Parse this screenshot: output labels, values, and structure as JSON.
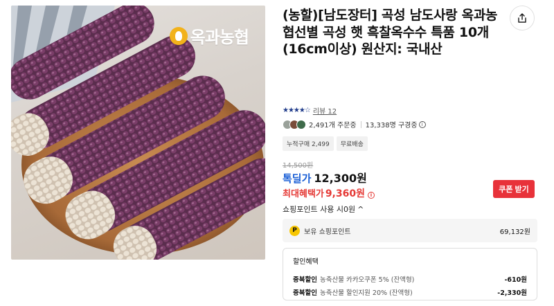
{
  "product": {
    "brand_logo_text": "옥과농협",
    "title": "(농할)[남도장터] 곡성 남도사랑 옥과농협선별 곡성 햇 흑찰옥수수 특품 10개 (16cm이상) 원산지: 국내산"
  },
  "rating": {
    "stars": "★★★★☆",
    "review_label": "리뷰 12"
  },
  "stats": {
    "order_count": "2,491개 주문중",
    "view_count": "13,338명 구경중",
    "info_glyph": "i"
  },
  "tags": [
    "누적구매 2,499",
    "무료배송"
  ],
  "price": {
    "original": "14,500원",
    "label": "톡딜가",
    "value": "12,300원",
    "max_label": "최대혜택가",
    "max_value": "9,360원"
  },
  "coupon_button": "쿠폰 받기",
  "points": {
    "toggle_label": "쇼핑포인트 사용 시0원",
    "toggle_icon": "^",
    "icon_letter": "P",
    "label": "보유 쇼핑포인트",
    "amount": "69,132원"
  },
  "discount": {
    "title": "할인혜택",
    "lines": [
      {
        "kind": "중복할인",
        "desc": "농축산물 카카오쿠폰 5% (잔액형)",
        "amount": "-610원"
      },
      {
        "kind": "중복할인",
        "desc": "농축산물 할인지원 20% (잔액형)",
        "amount": "-2,330원"
      }
    ]
  },
  "colors": {
    "deal_blue": "#1a5fd6",
    "benefit_red": "#e53935",
    "coupon_red": "#e8323a",
    "star_navy": "#1e3a8a",
    "point_yellow": "#f7c600"
  },
  "icons": {
    "share": "share-icon",
    "logo": "ricegrain-logo-icon"
  }
}
